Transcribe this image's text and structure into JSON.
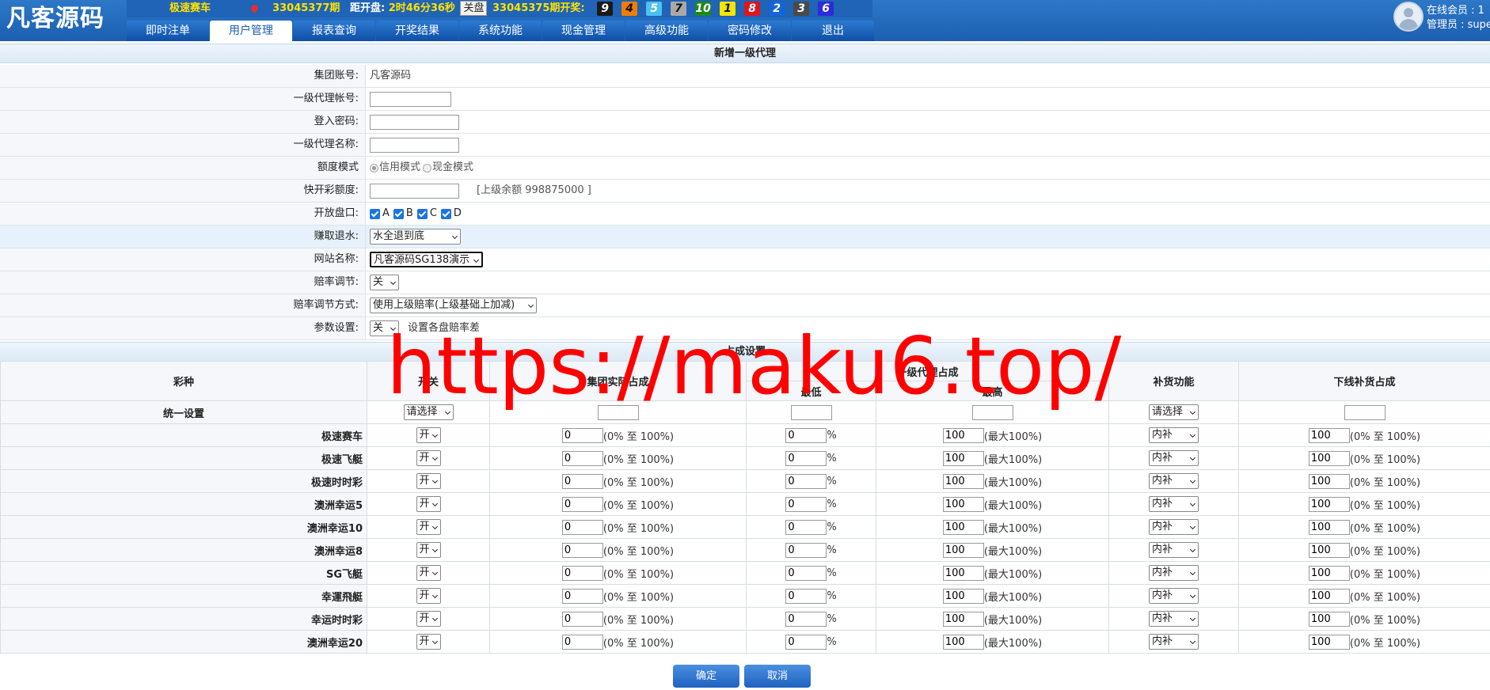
{
  "header": {
    "logo": "凡客源码",
    "game_name": "极速赛车",
    "current_period": "33045377期",
    "countdown_label": "距开盘:",
    "countdown_value": "2时46分36秒",
    "close_label": "关盘",
    "last_period": "33045375期开奖:",
    "result_balls": [
      {
        "n": "9",
        "color": "#1a1a1a",
        "text_color": "#ffffff"
      },
      {
        "n": "4",
        "color": "#f07d00",
        "text_color": "#111111"
      },
      {
        "n": "5",
        "color": "#4cc2f0",
        "text_color": "#ffffff"
      },
      {
        "n": "7",
        "color": "#a8a8a8",
        "text_color": "#111111"
      },
      {
        "n": "10",
        "color": "#1c8a1c",
        "text_color": "#ffffff"
      },
      {
        "n": "1",
        "color": "#f3e600",
        "text_color": "#111111"
      },
      {
        "n": "8",
        "color": "#e0141e",
        "text_color": "#ffffff"
      },
      {
        "n": "2",
        "color": "#1565d8",
        "text_color": "#ffffff"
      },
      {
        "n": "3",
        "color": "#4a4a4a",
        "text_color": "#ffffff"
      },
      {
        "n": "6",
        "color": "#2b2bd9",
        "text_color": "#ffffff"
      }
    ],
    "nav_tabs": [
      "即时注单",
      "用户管理",
      "报表查询",
      "开奖结果",
      "系统功能",
      "现金管理",
      "高级功能",
      "密码修改",
      "退出"
    ],
    "active_tab": "用户管理",
    "online_label": "在线会员 : 1",
    "admin_label": "管理员 : supe"
  },
  "form": {
    "title": "新增一级代理",
    "group_account_label": "集团账号:",
    "group_account_value": "凡客源码",
    "agent_account_label": "一级代理帐号:",
    "password_label": "登入密码:",
    "agent_name_label": "一级代理名称:",
    "quota_mode_label": "额度模式",
    "quota_mode_credit": "信用模式",
    "quota_mode_cash": "现金模式",
    "quick_quota_label": "快开彩额度:",
    "parent_balance": "[上级余额 998875000 ]",
    "open_market_label": "开放盘口:",
    "markets": [
      "A",
      "B",
      "C",
      "D"
    ],
    "rebate_label": "赚取退水:",
    "rebate_value": "水全退到底",
    "site_name_label": "网站名称:",
    "site_name_value": "凡客源码SG138演示",
    "odds_adjust_label": "赔率调节:",
    "odds_adjust_value": "关",
    "odds_method_label": "赔率调节方式:",
    "odds_method_value": "使用上级赔率(上级基础上加减)",
    "param_label": "参数设置:",
    "param_value": "关",
    "param_hint": "设置各盘赔率差"
  },
  "share": {
    "title": "占成设置",
    "headers": {
      "lottery": "彩种",
      "switch": "开关",
      "group_share": "集团实际占成",
      "agent_share": "一级代理占成",
      "min": "最低",
      "max": "最高",
      "refill": "补货功能",
      "downline_refill": "下线补货占成"
    },
    "unified": {
      "label": "统一设置",
      "switch_select": "请选择",
      "refill_select": "请选择"
    },
    "group_hint": "(0% 至 100%)",
    "percent": "%",
    "max_hint": "(最大100%)",
    "downline_hint": "(0% 至 100%)",
    "rows": [
      {
        "name": "极速赛车",
        "switch": "开",
        "group": "0",
        "min": "0",
        "max": "100",
        "refill": "内补",
        "downline": "100"
      },
      {
        "name": "极速飞艇",
        "switch": "开",
        "group": "0",
        "min": "0",
        "max": "100",
        "refill": "内补",
        "downline": "100"
      },
      {
        "name": "极速时时彩",
        "switch": "开",
        "group": "0",
        "min": "0",
        "max": "100",
        "refill": "内补",
        "downline": "100"
      },
      {
        "name": "澳洲幸运5",
        "switch": "开",
        "group": "0",
        "min": "0",
        "max": "100",
        "refill": "内补",
        "downline": "100"
      },
      {
        "name": "澳洲幸运10",
        "switch": "开",
        "group": "0",
        "min": "0",
        "max": "100",
        "refill": "内补",
        "downline": "100"
      },
      {
        "name": "澳洲幸运8",
        "switch": "开",
        "group": "0",
        "min": "0",
        "max": "100",
        "refill": "内补",
        "downline": "100"
      },
      {
        "name": "SG飞艇",
        "switch": "开",
        "group": "0",
        "min": "0",
        "max": "100",
        "refill": "内补",
        "downline": "100"
      },
      {
        "name": "幸運飛艇",
        "switch": "开",
        "group": "0",
        "min": "0",
        "max": "100",
        "refill": "内补",
        "downline": "100"
      },
      {
        "name": "幸运时时彩",
        "switch": "开",
        "group": "0",
        "min": "0",
        "max": "100",
        "refill": "内补",
        "downline": "100"
      },
      {
        "name": "澳洲幸运20",
        "switch": "开",
        "group": "0",
        "min": "0",
        "max": "100",
        "refill": "内补",
        "downline": "100"
      }
    ]
  },
  "buttons": {
    "confirm": "确定",
    "cancel": "取消"
  },
  "watermark": "https://maku6.top/"
}
